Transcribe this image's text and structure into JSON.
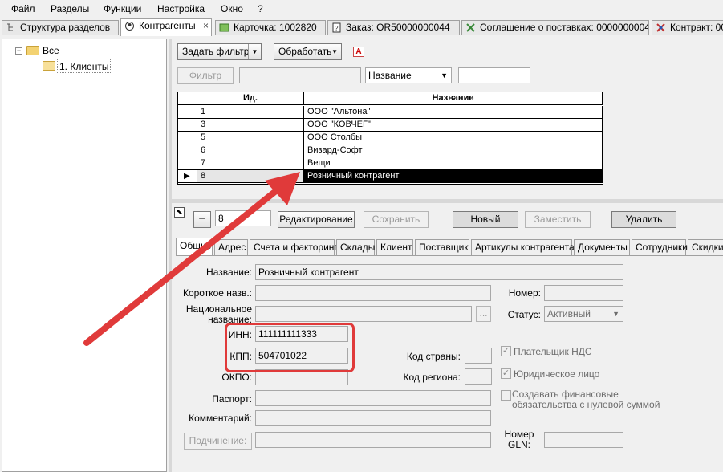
{
  "menu": [
    "Файл",
    "Разделы",
    "Функции",
    "Настройка",
    "Окно",
    "?"
  ],
  "tabs": [
    {
      "label": "Структура разделов",
      "icon": "tree-icon"
    },
    {
      "label": "Контрагенты",
      "icon": "contractors-icon",
      "close": "×"
    },
    {
      "label": "Карточка: 1002820",
      "icon": "card-icon"
    },
    {
      "label": "Заказ: OR50000000044",
      "icon": "order-icon"
    },
    {
      "label": "Соглашение о поставках: 0000000004",
      "icon": "agreement-icon"
    },
    {
      "label": "Контракт: 00",
      "icon": "contract-icon"
    }
  ],
  "tree": {
    "root": "Все",
    "expander": "−",
    "child": "1. Клиенты"
  },
  "toolbar": {
    "filter_button": "Задать фильтр",
    "process_button": "Обработать",
    "a_icon": "A",
    "filter_label": "Фильтр",
    "field_select": "Название"
  },
  "grid": {
    "columns": [
      "Ид.",
      "Название"
    ],
    "rows": [
      {
        "id": "1",
        "name": "ООО \"Альтона\""
      },
      {
        "id": "3",
        "name": "ООО \"КОВЧЕГ\""
      },
      {
        "id": "5",
        "name": "ООО Столбы"
      },
      {
        "id": "6",
        "name": "Визард-Софт"
      },
      {
        "id": "7",
        "name": "Вещи"
      },
      {
        "id": "8",
        "name": "Розничный контрагент",
        "selected": true
      }
    ]
  },
  "record": {
    "id_value": "8",
    "edit_button": "Редактирование",
    "save_button": "Сохранить",
    "new_button": "Новый",
    "replace_button": "Заместить",
    "delete_button": "Удалить"
  },
  "detail_tabs": [
    "Общие",
    "Адрес",
    "Счета и факторинг",
    "Склады",
    "Клиент",
    "Поставщик",
    "Артикулы контрагента",
    "Документы",
    "Сотрудники",
    "Скидки"
  ],
  "form": {
    "name_label": "Название:",
    "name_value": "Розничный контрагент",
    "short_label": "Короткое назв.:",
    "national_label_1": "Национальное",
    "national_label_2": "название:",
    "ellipsis": "...",
    "inn_label": "ИНН:",
    "inn_value": "111111111333",
    "kpp_label": "КПП:",
    "kpp_value": "504701022",
    "okpo_label": "ОКПО:",
    "passport_label": "Паспорт:",
    "comment_label": "Комментарий:",
    "subordination_button": "Подчинение:",
    "number_label": "Номер:",
    "status_label": "Статус:",
    "status_value": "Активный",
    "country_code_label": "Код страны:",
    "region_code_label": "Код региона:",
    "vat_payer_label": "Плательщик НДС",
    "legal_entity_label": "Юридическое лицо",
    "create_fin_label_1": "Создавать финансовые",
    "create_fin_label_2": "обязательства с нулевой суммой",
    "gln_label_1": "Номер",
    "gln_label_2": "GLN:",
    "check_mark": "✓"
  },
  "colors": {
    "annotation": "#e03a3a",
    "selection": "#000000"
  }
}
